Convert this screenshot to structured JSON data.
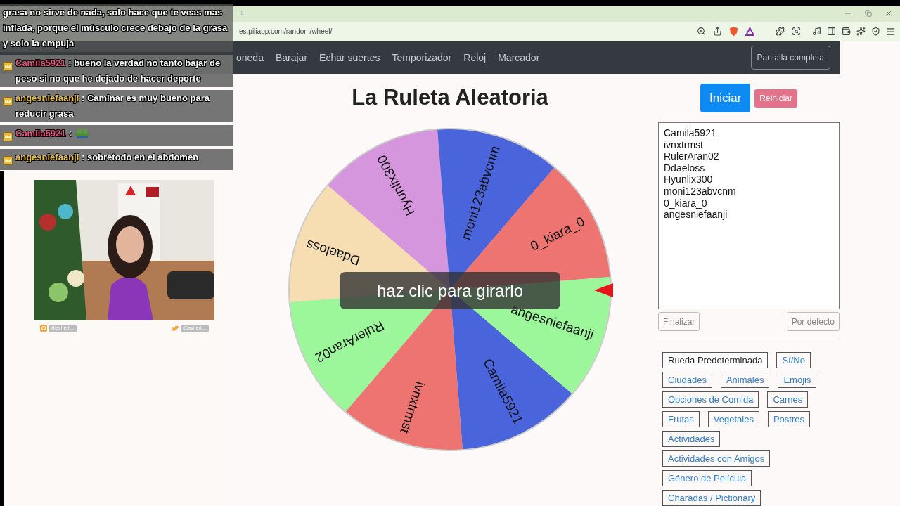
{
  "browser": {
    "new_tab": "+",
    "url": "es.piliapp.com/random/wheel/"
  },
  "nav": {
    "items": [
      "oneda",
      "Barajar",
      "Echar suertes",
      "Temporizador",
      "Reloj",
      "Marcador"
    ],
    "fullscreen_button": "Pantalla completa"
  },
  "title": "La Ruleta Aleatoria",
  "start_button": "Iniciar",
  "reset_button": "Reiniciar",
  "wheel": {
    "overlay": "haz clic para girarlo",
    "segments": [
      {
        "label": "Camila5921",
        "color": "#4a64dc"
      },
      {
        "label": "ivnxtrmst",
        "color": "#ee7471"
      },
      {
        "label": "RulerAran02",
        "color": "#9cf79a"
      },
      {
        "label": "Ddaeloss",
        "color": "#f6deb2"
      },
      {
        "label": "Hyunlix300",
        "color": "#d596de"
      },
      {
        "label": "moni123abvcnm",
        "color": "#4a64dc"
      },
      {
        "label": "0_kiara_0",
        "color": "#ee7471"
      },
      {
        "label": "angesniefaanji",
        "color": "#9cf79a"
      }
    ]
  },
  "names_field": {
    "lines": [
      "Camila5921",
      "ivnxtrmst",
      "RulerAran02",
      "Ddaeloss",
      "Hyunlix300",
      "moni123abvcnm",
      "0_kiara_0",
      "angesniefaanji"
    ]
  },
  "finish_button": "Finalizar",
  "default_button": "Por defecto",
  "preset_rows": [
    [
      {
        "label": "Rueda Predeterminada",
        "selected": true
      },
      {
        "label": "Sí/No",
        "selected": false
      }
    ],
    [
      {
        "label": "Ciudades",
        "selected": false
      },
      {
        "label": "Animales",
        "selected": false
      },
      {
        "label": "Emojis",
        "selected": false
      }
    ],
    [
      {
        "label": "Opciones de Comida",
        "selected": false
      },
      {
        "label": "Carnes",
        "selected": false
      }
    ],
    [
      {
        "label": "Frutas",
        "selected": false
      },
      {
        "label": "Vegetales",
        "selected": false
      },
      {
        "label": "Postres",
        "selected": false
      }
    ],
    [
      {
        "label": "Actividades",
        "selected": false
      }
    ],
    [
      {
        "label": "Actividades con Amigos",
        "selected": false
      }
    ],
    [
      {
        "label": "Género de Película",
        "selected": false
      }
    ],
    [
      {
        "label": "Charadas / Pictionary",
        "selected": false
      }
    ]
  ],
  "chat": {
    "messages": [
      {
        "kind": "continuation",
        "text": "grasa no sirve de nada, solo hace que te veas mas inflada, porque el músculo crece debajo de la grasa y solo la empuja"
      },
      {
        "kind": "text",
        "user": "Camila5921",
        "color": "#e8507f",
        "sep": ":",
        "text": "bueno la verdad no tanto bajar de peso si no que he dejado de hacer deporte"
      },
      {
        "kind": "text",
        "user": "angesniefaanji",
        "color": "#e8c04a",
        "sep": ":",
        "text": "Caminar es muy bueno para reducir grasa"
      },
      {
        "kind": "emote",
        "user": "Camila5921",
        "color": "#e8507f",
        "sep": ":"
      },
      {
        "kind": "text",
        "user": "angesniefaanji",
        "color": "#e8c04a",
        "sep": ":",
        "text": "sobretodo en el abdomen"
      }
    ]
  },
  "webcam": {
    "kind": "picture",
    "handles": [
      {
        "kind": "instagram",
        "text": "@asherit..."
      },
      {
        "kind": "twitter",
        "text": "@asherit..."
      }
    ]
  }
}
